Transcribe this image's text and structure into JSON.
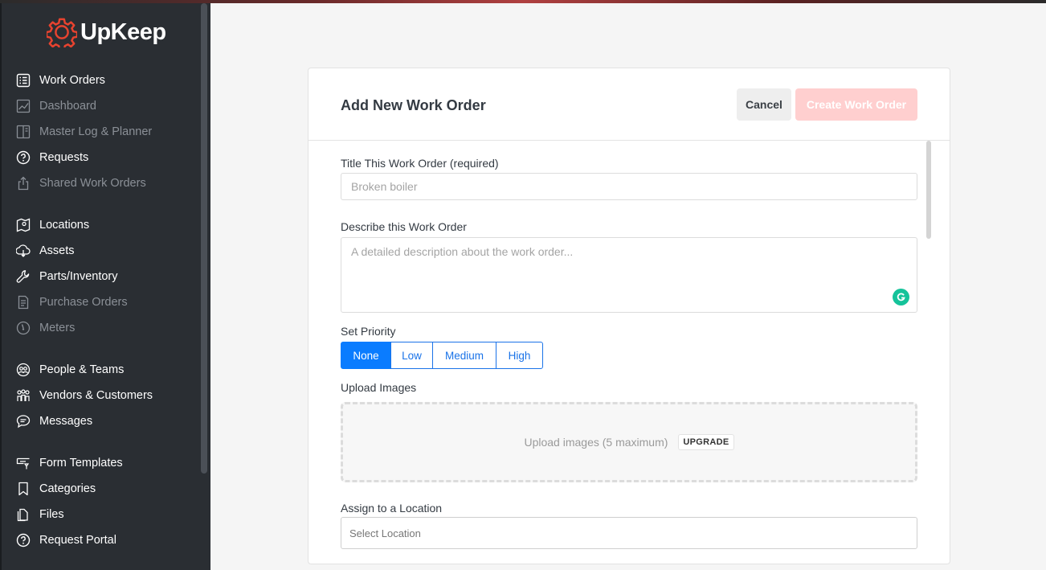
{
  "app": {
    "name": "UpKeep",
    "accent": "#e8432f"
  },
  "sidebar": {
    "items": [
      {
        "label": "Work Orders",
        "icon": "list-icon",
        "active": true
      },
      {
        "label": "Dashboard",
        "icon": "chart-icon",
        "dim": true
      },
      {
        "label": "Master Log & Planner",
        "icon": "planner-icon",
        "dim": true
      },
      {
        "label": "Requests",
        "icon": "question-icon"
      },
      {
        "label": "Shared Work Orders",
        "icon": "share-icon",
        "dim": true
      },
      {
        "label": "Locations",
        "icon": "map-icon"
      },
      {
        "label": "Assets",
        "icon": "asset-icon"
      },
      {
        "label": "Parts/Inventory",
        "icon": "wrench-icon"
      },
      {
        "label": "Purchase Orders",
        "icon": "document-icon",
        "dim": true
      },
      {
        "label": "Meters",
        "icon": "meter-icon",
        "dim": true
      },
      {
        "label": "People & Teams",
        "icon": "people-icon"
      },
      {
        "label": "Vendors & Customers",
        "icon": "vendors-icon"
      },
      {
        "label": "Messages",
        "icon": "chat-icon"
      },
      {
        "label": "Form Templates",
        "icon": "form-icon"
      },
      {
        "label": "Categories",
        "icon": "bookmark-icon"
      },
      {
        "label": "Files",
        "icon": "files-icon"
      },
      {
        "label": "Request Portal",
        "icon": "question-icon"
      }
    ]
  },
  "form": {
    "title": "Add New Work Order",
    "cancel_label": "Cancel",
    "create_label": "Create Work Order",
    "title_label": "Title This Work Order (required)",
    "title_placeholder": "Broken boiler",
    "description_label": "Describe this Work Order",
    "description_placeholder": "A detailed description about the work order...",
    "priority_label": "Set Priority",
    "priority_options": [
      "None",
      "Low",
      "Medium",
      "High"
    ],
    "priority_selected": "None",
    "upload_label": "Upload Images",
    "upload_text": "Upload images (5 maximum)",
    "upgrade_label": "UPGRADE",
    "location_label": "Assign to a Location",
    "location_placeholder": "Select Location"
  }
}
